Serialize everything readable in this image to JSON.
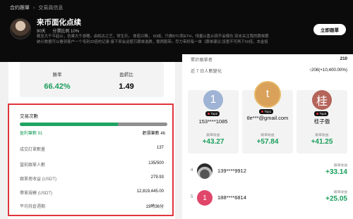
{
  "breadcrumb": {
    "parent": "合约跟單",
    "current": "交易員信息"
  },
  "trader": {
    "name": "来币面化点续",
    "followers": "90天",
    "profit_share": "分潤比例 10%",
    "bio": "截至大千平起止，告乘大千游穗，由知古之艺，常生乐。 体若兴稚， 60成，只做BTC和ETH，恒量止盈止损不会爆仓 双击关注我的跟单跟统计数据可以看到客户一个毛利20倍的记录 接下来会运使万跟单选跌，稳两跑带。尽力带好每一单（跟单建议:设置不可再下50倍，本金投入少量分跟20倍跟随，切勿十..."
  },
  "follow_button": "立即跟單",
  "summary": {
    "win_rate_label": "勝率",
    "win_rate": "66.42%",
    "pl_ratio_label": "盈虧比",
    "pl_ratio": "1.49"
  },
  "trades": {
    "title": "交易次數",
    "win_label": "盈利筆數 91",
    "loss_label": "虧損筆數 46",
    "win_fraction": 0.6642,
    "rows": [
      {
        "key": "成交訂單數量",
        "value": "137"
      },
      {
        "key": "當前跟單人數",
        "value": "135/500"
      },
      {
        "key": "跟單者收益 (USDT)",
        "value": "279.93"
      },
      {
        "key": "帶單規模 (USDT)",
        "value": "12,819,445.00"
      },
      {
        "key": "平均持倉週期",
        "value": "19時36分"
      }
    ]
  },
  "right": {
    "total_label": "累計跟單者",
    "total_value": "210",
    "change_label": "近 7 日人數變化",
    "change_value": "↑208(+10,400.00%)",
    "podium": [
      {
        "avatar_letter": "1",
        "badge": "Top2",
        "name": "153****1085",
        "profit_label": "跟單收益",
        "profit": "+43.27",
        "color": "#9fb3d4"
      },
      {
        "avatar_letter": "t",
        "badge": "Top1",
        "name": "tle***@gmail.com",
        "profit_label": "跟單收益",
        "profit": "+57.84",
        "color": "#d9a15a"
      },
      {
        "avatar_letter": "桂",
        "badge": "Top3",
        "name": "桂子傲",
        "profit_label": "跟單收益",
        "profit": "+41.25",
        "color": "#b5645a"
      }
    ],
    "list": [
      {
        "rank": "4",
        "name": "139****9912",
        "profit_label": "跟單收益",
        "profit": "+33.14"
      },
      {
        "rank": "5",
        "avatar_letter": "1",
        "name": "188****6814",
        "profit_label": "跟單收益",
        "profit": "+25.05"
      }
    ]
  }
}
